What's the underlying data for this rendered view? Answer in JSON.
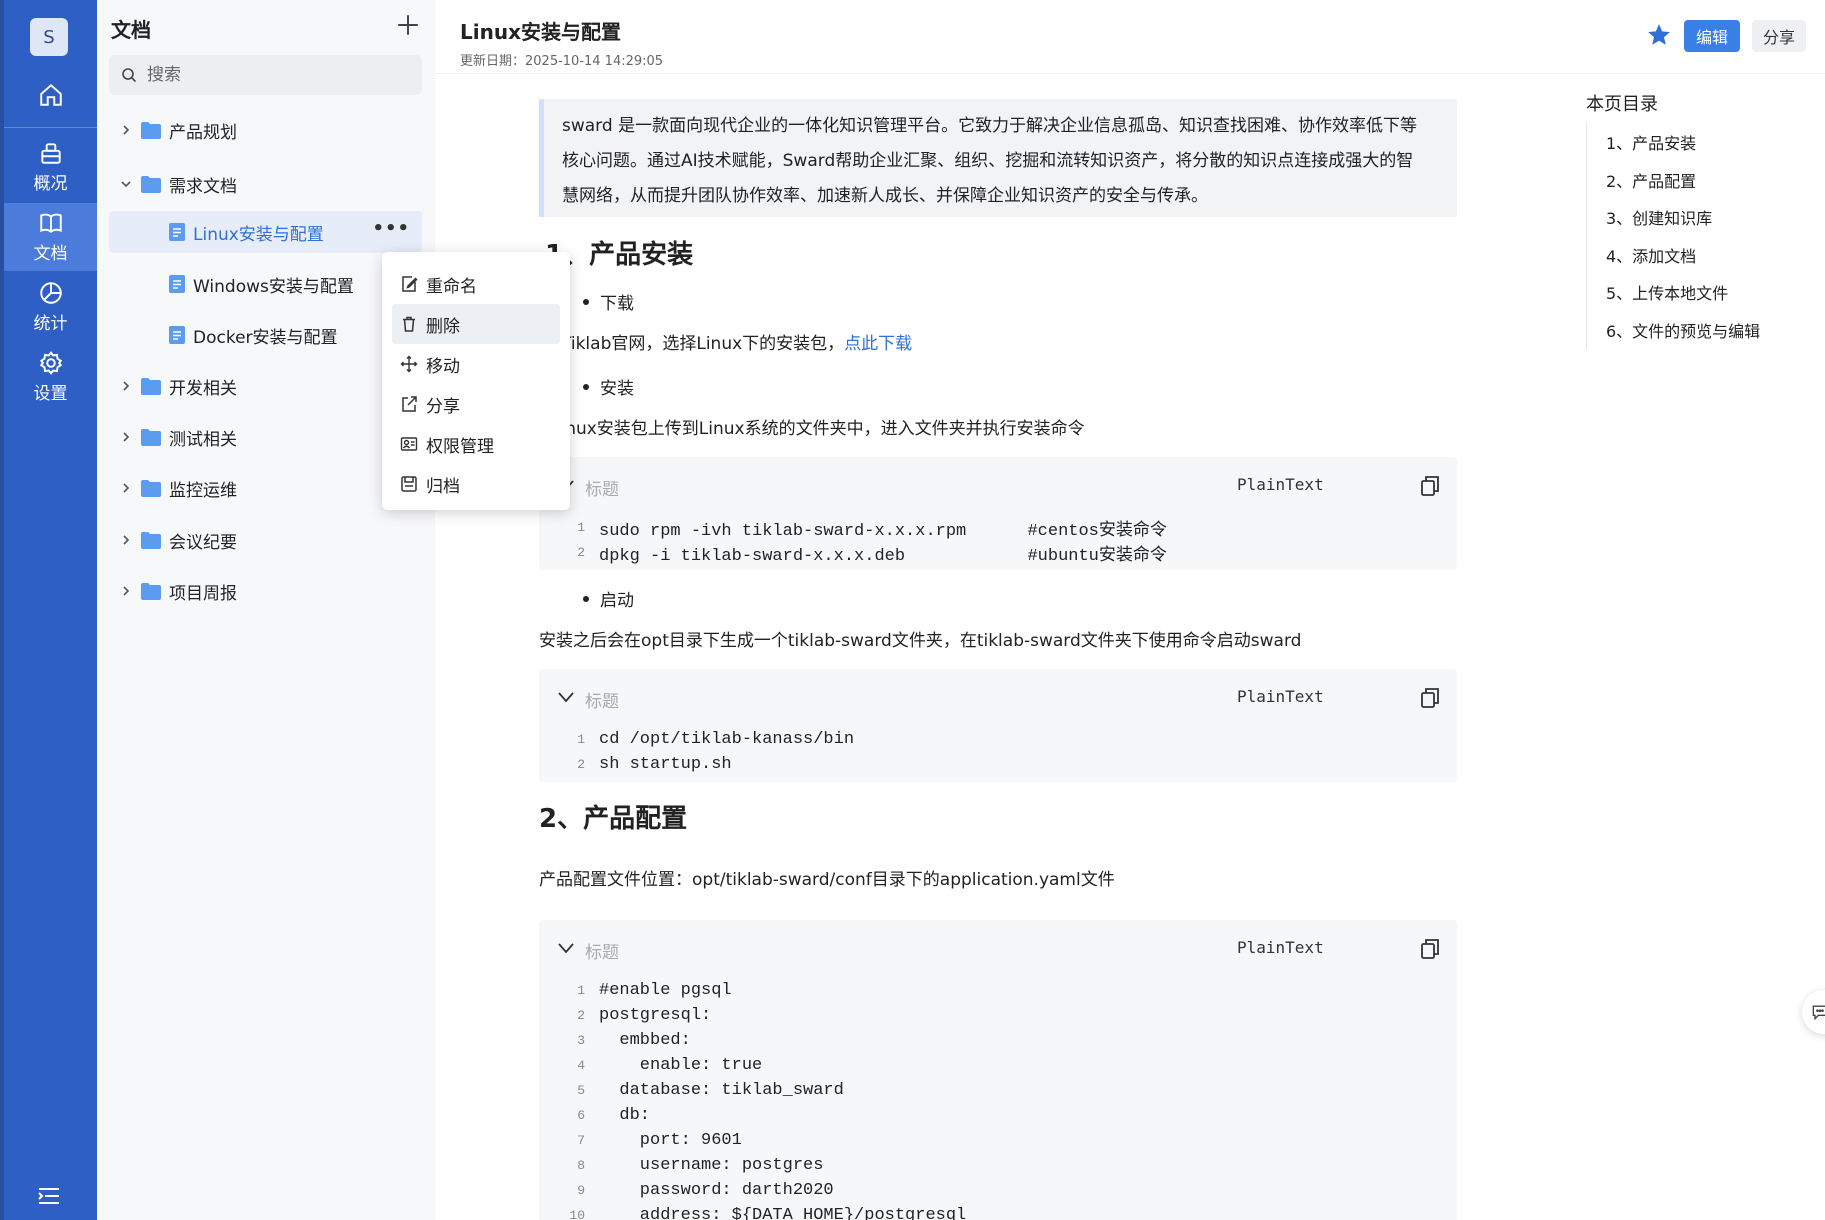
{
  "rail": {
    "avatar": "S",
    "items": [
      {
        "label": "概况"
      },
      {
        "label": "文档"
      },
      {
        "label": "统计"
      },
      {
        "label": "设置"
      }
    ]
  },
  "tree": {
    "title": "文档",
    "search_placeholder": "搜索",
    "nodes": [
      {
        "label": "产品规划"
      },
      {
        "label": "需求文档"
      },
      {
        "label": "Linux安装与配置"
      },
      {
        "label": "Windows安装与配置"
      },
      {
        "label": "Docker安装与配置"
      },
      {
        "label": "开发相关"
      },
      {
        "label": "测试相关"
      },
      {
        "label": "监控运维"
      },
      {
        "label": "会议纪要"
      },
      {
        "label": "项目周报"
      }
    ]
  },
  "context_menu": {
    "items": [
      {
        "label": "重命名"
      },
      {
        "label": "删除"
      },
      {
        "label": "移动"
      },
      {
        "label": "分享"
      },
      {
        "label": "权限管理"
      },
      {
        "label": "归档"
      }
    ]
  },
  "header": {
    "title": "Linux安装与配置",
    "updated": "更新日期：2025-10-14 14:29:05",
    "edit_label": "编辑",
    "share_label": "分享",
    "accent": "#3a7fe6"
  },
  "doc": {
    "intro_lines": [
      "sward 是一款面向现代企业的一体化知识管理平台。它致力于解决企业信息孤岛、知识查找困难、协作效率低下等",
      "核心问题。通过AI技术赋能，Sward帮助企业汇聚、组织、挖掘和流转知识资产，将分散的知识点连接成强大的智",
      "慧网络，从而提升团队协作效率、加速新人成长、并保障企业知识资产的安全与传承。"
    ],
    "h1_install": "1、产品安装",
    "bullet_download": "下载",
    "para_download": "进Tiklab官网，选择Linux下的安装包，",
    "link_download": "点此下载",
    "bullet_install": "安装",
    "para_install": "Linux安装包上传到Linux系统的文件夹中，进入文件夹并执行安装命令",
    "code1": {
      "title": "标题",
      "lang": "PlainText",
      "lines": [
        "sudo rpm -ivh tiklab-sward-x.x.x.rpm      #centos安装命令",
        "dpkg -i tiklab-sward-x.x.x.deb            #ubuntu安装命令"
      ]
    },
    "bullet_start": "启动",
    "para_start": "安装之后会在opt目录下生成一个tiklab-sward文件夹，在tiklab-sward文件夹下使用命令启动sward",
    "code2": {
      "title": "标题",
      "lang": "PlainText",
      "lines": [
        "cd /opt/tiklab-kanass/bin",
        "sh startup.sh"
      ]
    },
    "h1_config": "2、产品配置",
    "para_config": "产品配置文件位置：opt/tiklab-sward/conf目录下的application.yaml文件",
    "code3": {
      "title": "标题",
      "lang": "PlainText",
      "lines": [
        "#enable pgsql",
        "postgresql:",
        "  embbed:",
        "    enable: true",
        "  database: tiklab_sward",
        "  db:",
        "    port: 9601",
        "    username: postgres",
        "    password: darth2020",
        "    address: ${DATA_HOME}/postgresql"
      ]
    }
  },
  "toc": {
    "title": "本页目录",
    "items": [
      "1、产品安装",
      "2、产品配置",
      "3、创建知识库",
      "4、添加文档",
      "5、上传本地文件",
      "6、文件的预览与编辑"
    ]
  }
}
